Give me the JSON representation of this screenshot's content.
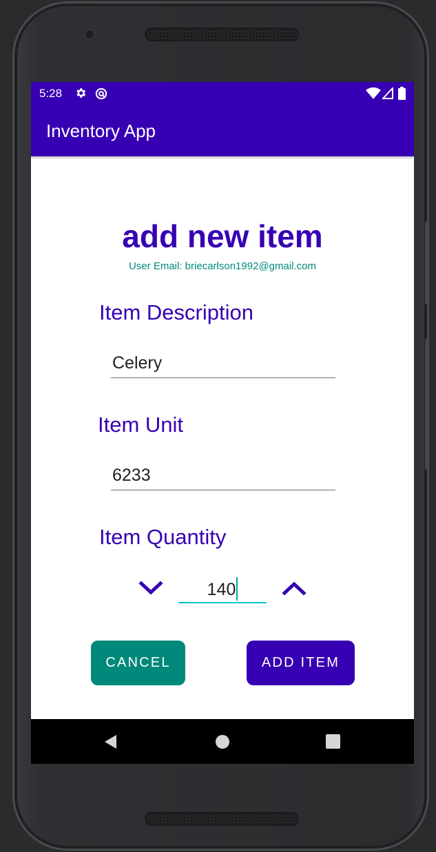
{
  "status_bar": {
    "time": "5:28"
  },
  "app_bar": {
    "title": "Inventory App"
  },
  "form": {
    "heading": "add new item",
    "user_email": "User Email: briecarlson1992@gmail.com",
    "description_label": "Item Description",
    "description_value": "Celery",
    "unit_label": "Item Unit",
    "unit_value": "6233",
    "quantity_label": "Item Quantity",
    "quantity_value": "140"
  },
  "buttons": {
    "cancel": "CANCEL",
    "add": "ADD ITEM"
  },
  "colors": {
    "primary": "#3700b3",
    "accent_teal": "#00897b",
    "input_focus": "#00c8c8"
  },
  "icons": {
    "status": [
      "settings-icon",
      "sync-icon",
      "wifi-icon",
      "signal-icon",
      "battery-icon"
    ],
    "quantity": [
      "chevron-down-icon",
      "chevron-up-icon"
    ],
    "nav": [
      "back-icon",
      "home-icon",
      "recents-icon"
    ]
  }
}
